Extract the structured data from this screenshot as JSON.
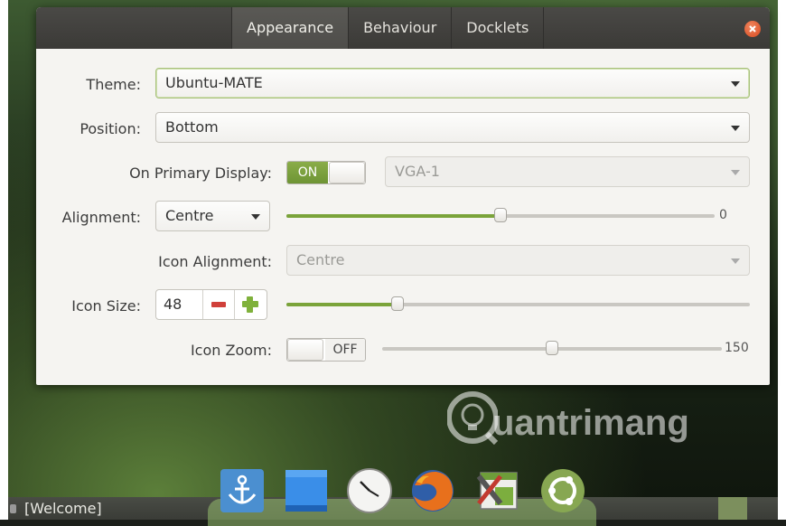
{
  "tabs": [
    "Appearance",
    "Behaviour",
    "Docklets"
  ],
  "active_tab": "Appearance",
  "theme": {
    "label": "Theme:",
    "value": "Ubuntu-MATE"
  },
  "position": {
    "label": "Position:",
    "value": "Bottom"
  },
  "primary_display": {
    "label": "On Primary Display:",
    "switch_state": "ON",
    "monitor": "VGA-1"
  },
  "alignment": {
    "label": "Alignment:",
    "value": "Centre",
    "offset_value": "0",
    "offset_fraction": 0.5
  },
  "icon_alignment": {
    "label": "Icon Alignment:",
    "value": "Centre"
  },
  "icon_size": {
    "label": "Icon Size:",
    "value": "48",
    "slider_fraction": 0.24
  },
  "icon_zoom": {
    "label": "Icon Zoom:",
    "switch_state": "OFF",
    "zoom_value": "150",
    "slider_fraction": 0.5
  },
  "dock_icons": [
    "anchor-icon",
    "window-icon",
    "clock-icon",
    "firefox-icon",
    "settings-icon",
    "ubuntu-mate-icon"
  ],
  "taskbar": {
    "window_label": "[Welcome]"
  },
  "watermark": "uantrimang",
  "colors": {
    "accent": "#7aa33a",
    "close": "#e0552b"
  }
}
